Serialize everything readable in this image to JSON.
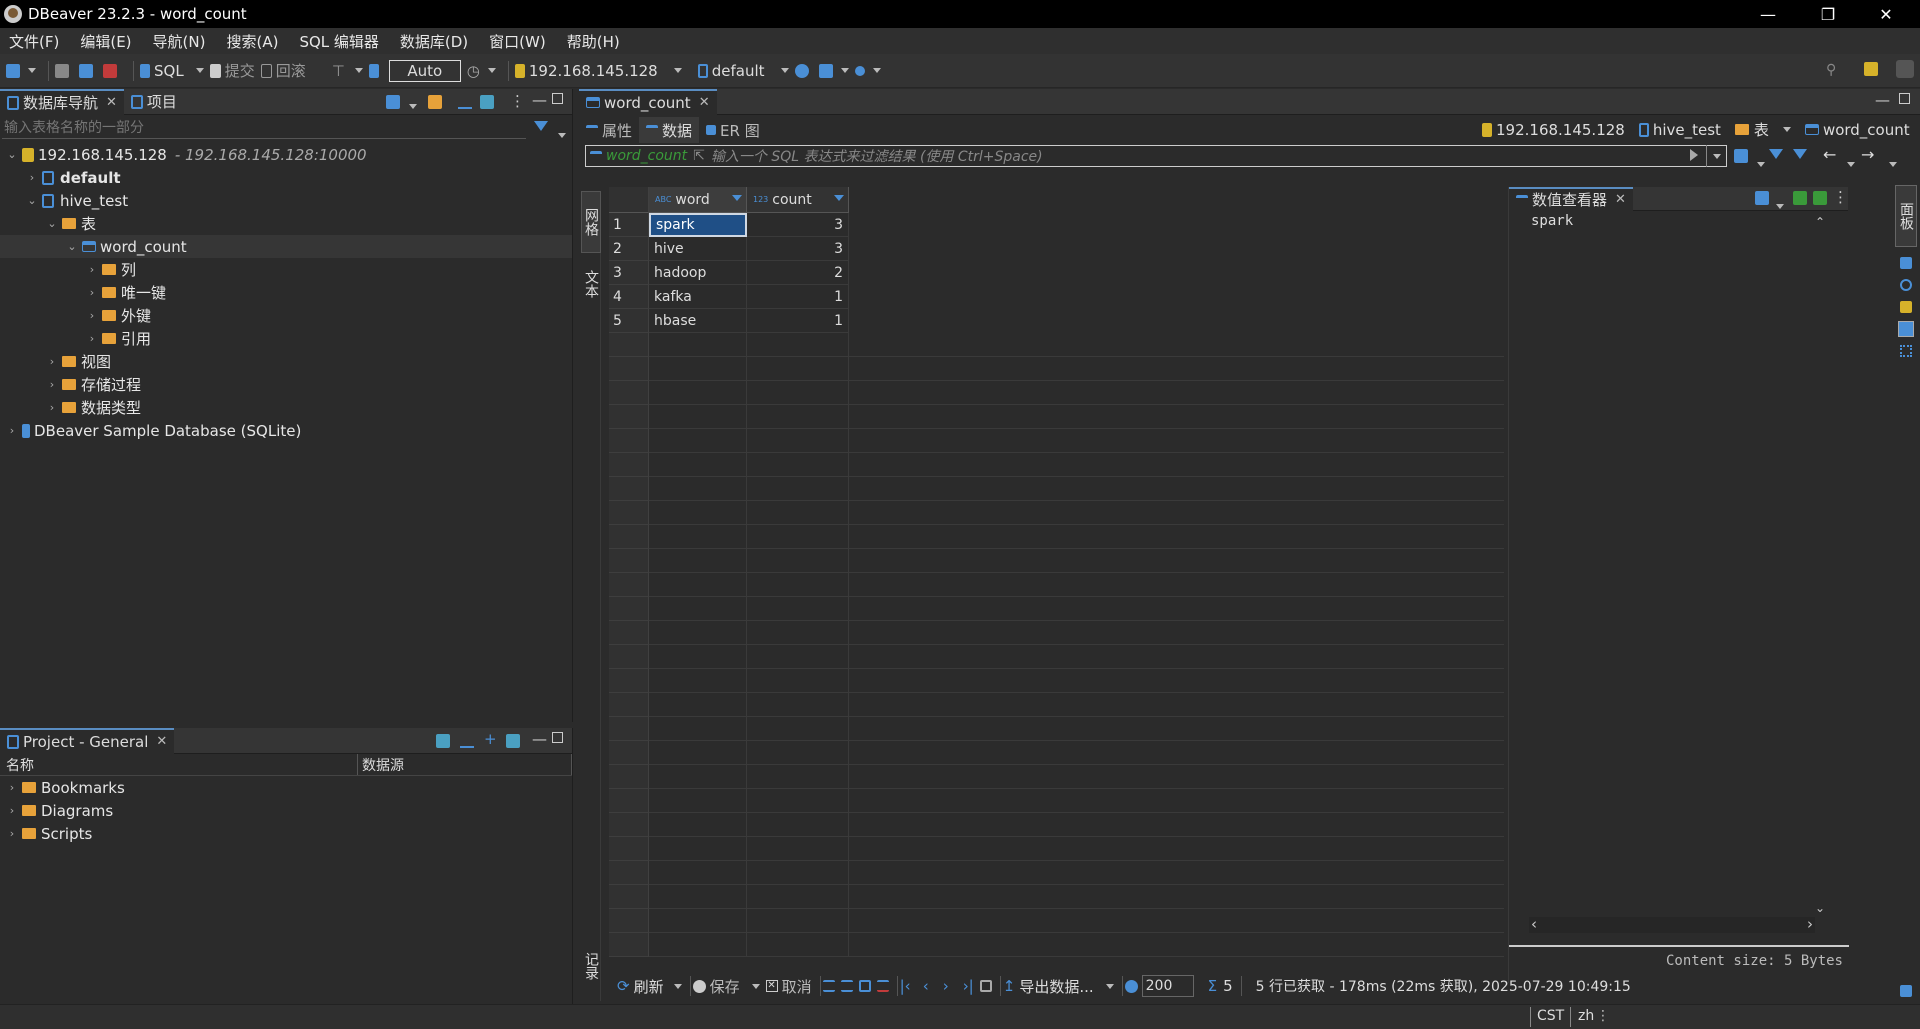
{
  "window": {
    "title": "DBeaver 23.2.3 - word_count"
  },
  "menu": [
    "文件(F)",
    "编辑(E)",
    "导航(N)",
    "搜索(A)",
    "SQL 编辑器",
    "数据库(D)",
    "窗口(W)",
    "帮助(H)"
  ],
  "toolbar": {
    "sql": "SQL",
    "commit": "提交",
    "rollback": "回滚",
    "mode": "Auto",
    "connection": "192.168.145.128",
    "schema": "default"
  },
  "navigator": {
    "tab_label": "数据库导航",
    "projects_tab": "项目",
    "filter_placeholder": "输入表格名称的一部分",
    "tree": [
      {
        "label": "192.168.145.128",
        "suffix": "- 192.168.145.128:10000"
      },
      {
        "label": "default"
      },
      {
        "label": "hive_test"
      },
      {
        "label": "表"
      },
      {
        "label": "word_count"
      },
      {
        "label": "列"
      },
      {
        "label": "唯一键"
      },
      {
        "label": "外键"
      },
      {
        "label": "引用"
      },
      {
        "label": "视图"
      },
      {
        "label": "存储过程"
      },
      {
        "label": "数据类型"
      },
      {
        "label": "DBeaver Sample Database (SQLite)"
      }
    ]
  },
  "project": {
    "tab_label": "Project - General",
    "col_name": "名称",
    "col_source": "数据源",
    "items": [
      "Bookmarks",
      "Diagrams",
      "Scripts"
    ]
  },
  "editor": {
    "tab_label": "word_count",
    "subtabs": [
      "属性",
      "数据",
      "ER 图"
    ],
    "crumbs": [
      "192.168.145.128",
      "hive_test",
      "表",
      "word_count"
    ],
    "filter_label": "word_count",
    "filter_placeholder": "输入一个 SQL 表达式来过滤结果 (使用 Ctrl+Space)",
    "side_tabs": [
      "网格",
      "文本",
      "记录"
    ]
  },
  "grid": {
    "columns": [
      {
        "name": "word",
        "type": "ABC"
      },
      {
        "name": "count",
        "type": "123"
      }
    ],
    "rows": [
      {
        "n": "1",
        "word": "spark",
        "count": "3"
      },
      {
        "n": "2",
        "word": "hive",
        "count": "3"
      },
      {
        "n": "3",
        "word": "hadoop",
        "count": "2"
      },
      {
        "n": "4",
        "word": "kafka",
        "count": "1"
      },
      {
        "n": "5",
        "word": "hbase",
        "count": "1"
      }
    ]
  },
  "value_viewer": {
    "tab_label": "数值查看器",
    "value": "spark",
    "content_size": "Content size: 5 Bytes",
    "side_tab": "面板"
  },
  "bottom_bar": {
    "refresh": "刷新",
    "save": "保存",
    "cancel": "取消",
    "export": "导出数据...",
    "fetch_size": "200",
    "count": "5",
    "result": "5 行已获取 - 178ms (22ms 获取), 2025-07-29 10:49:15"
  },
  "statusbar": {
    "tz": "CST",
    "locale": "zh"
  }
}
